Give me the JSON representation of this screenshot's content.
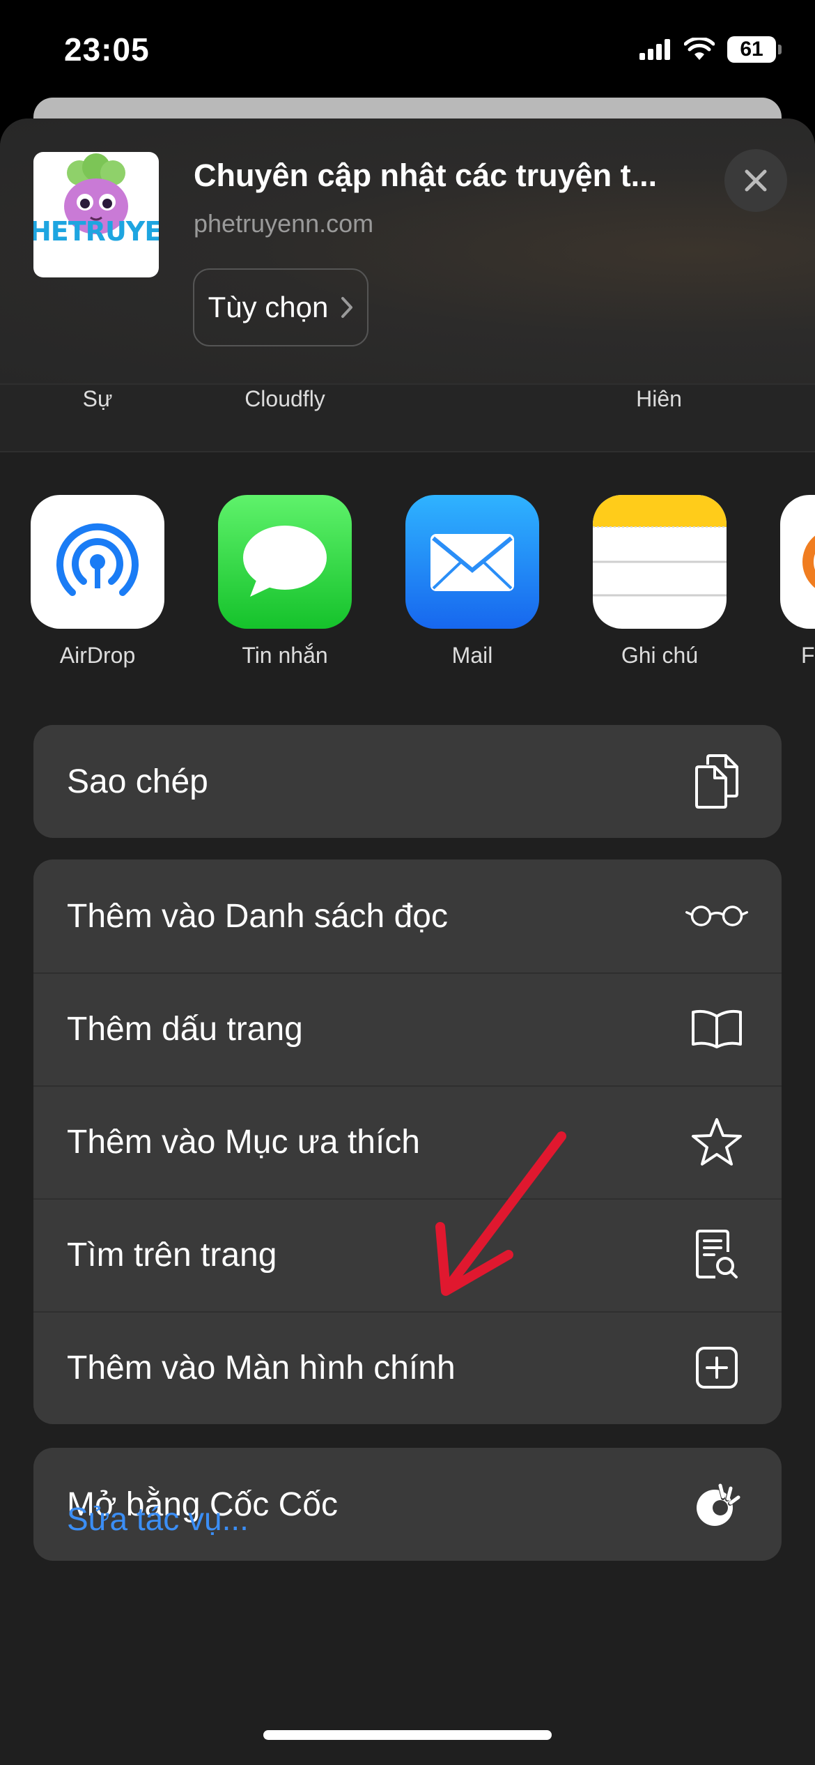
{
  "status_bar": {
    "time": "23:05",
    "battery": "61"
  },
  "site": {
    "thumb_text": "HETRUYEN",
    "title": "Chuyên cập nhật các truyện t...",
    "url": "phetruyenn.com",
    "options_label": "Tùy chọn"
  },
  "people": [
    "Sự",
    "Cloudfly",
    "Hiên"
  ],
  "apps": [
    {
      "label": "AirDrop"
    },
    {
      "label": "Tin nhắn"
    },
    {
      "label": "Mail"
    },
    {
      "label": "Ghi chú"
    },
    {
      "label": "Fr"
    }
  ],
  "actions": {
    "copy": "Sao chép",
    "reading_list": "Thêm vào Danh sách đọc",
    "bookmark": "Thêm dấu trang",
    "favorites": "Thêm vào Mục ưa thích",
    "find_on_page": "Tìm trên trang",
    "add_home_screen": "Thêm vào Màn hình chính",
    "open_coccoc": "Mở bằng Cốc Cốc",
    "edit_actions": "Sửa tác vụ..."
  },
  "colors": {
    "link": "#3b8ef5",
    "annotation_arrow": "#e0182f",
    "sheet_background": "#1f1f1f",
    "row_background": "#3a3a3a"
  }
}
